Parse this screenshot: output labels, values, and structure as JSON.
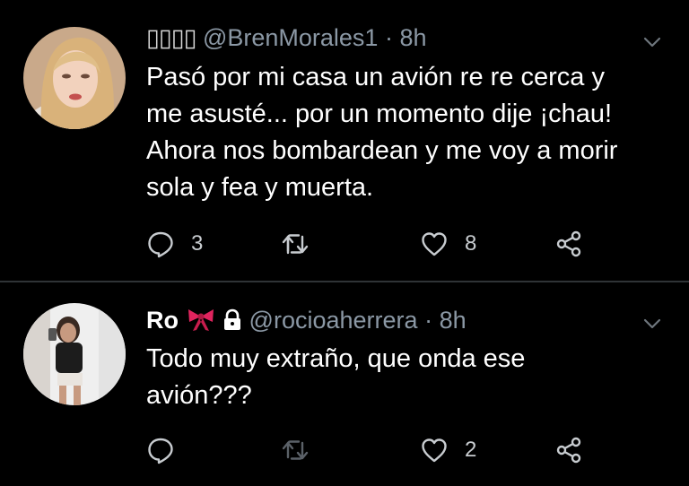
{
  "tweets": [
    {
      "name_glyphs": "▯▯▯▯",
      "handle": "@BrenMorales1",
      "separator": "·",
      "time": "8h",
      "text_lines": [
        "Pasó por mi casa un avión re re cerca y",
        "me asusté... por un momento dije ¡chau!",
        "Ahora nos bombardean y me voy a morir",
        "sola y fea y muerta."
      ],
      "replies": "3",
      "likes": "8"
    },
    {
      "name": "Ro",
      "handle": "@rocioaherrera",
      "separator": "·",
      "time": "8h",
      "text_lines": [
        "Todo muy extraño, que onda ese",
        "avión???"
      ],
      "likes": "2"
    }
  ],
  "icons": {
    "reply": "reply-icon",
    "retweet": "retweet-icon",
    "like": "heart-icon",
    "share": "share-icon",
    "caret": "chevron-down-icon",
    "bow": "ribbon-icon",
    "lock": "lock-icon"
  },
  "colors": {
    "background": "#000000",
    "text": "#ffffff",
    "secondary": "#8b98a5",
    "divider": "#2f3336",
    "bow": "#e0245e"
  }
}
